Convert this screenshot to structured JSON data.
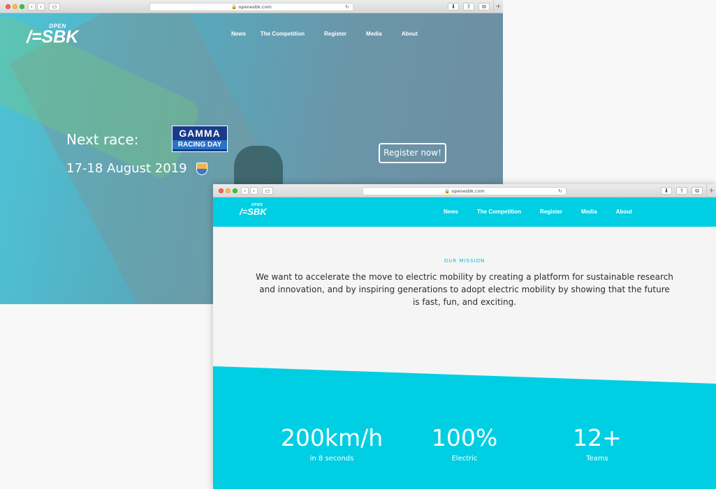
{
  "window1": {
    "url": "openesbk.com",
    "logo": {
      "top": "OPEN",
      "main": "SBK"
    },
    "nav": [
      "News",
      "The Competition",
      "Register",
      "Media",
      "About"
    ],
    "hero": {
      "next_race": "Next race:",
      "dates": "17-18 August 2019",
      "sponsor_line1": "GAMMA",
      "sponsor_line2": "RACING DAY",
      "register_button": "Register now!"
    }
  },
  "window2": {
    "url": "openesbk.com",
    "logo": {
      "top": "OPEN",
      "main": "SBK"
    },
    "nav": [
      "News",
      "The Competition",
      "Register",
      "Media",
      "About"
    ],
    "mission": {
      "heading": "OUR MISSION",
      "text": "We want to accelerate the move to electric mobility by creating a platform for sustainable research and innovation, and by inspiring generations to adopt electric mobility by showing that the future is fast, fun, and exciting."
    },
    "stats": [
      {
        "value": "200km/h",
        "label": "in 8 seconds"
      },
      {
        "value": "100%",
        "label": "Electric"
      },
      {
        "value": "12+",
        "label": "Teams"
      }
    ]
  },
  "colors": {
    "accent": "#00cfe3",
    "sponsor_blue": "#1a3b8a"
  }
}
